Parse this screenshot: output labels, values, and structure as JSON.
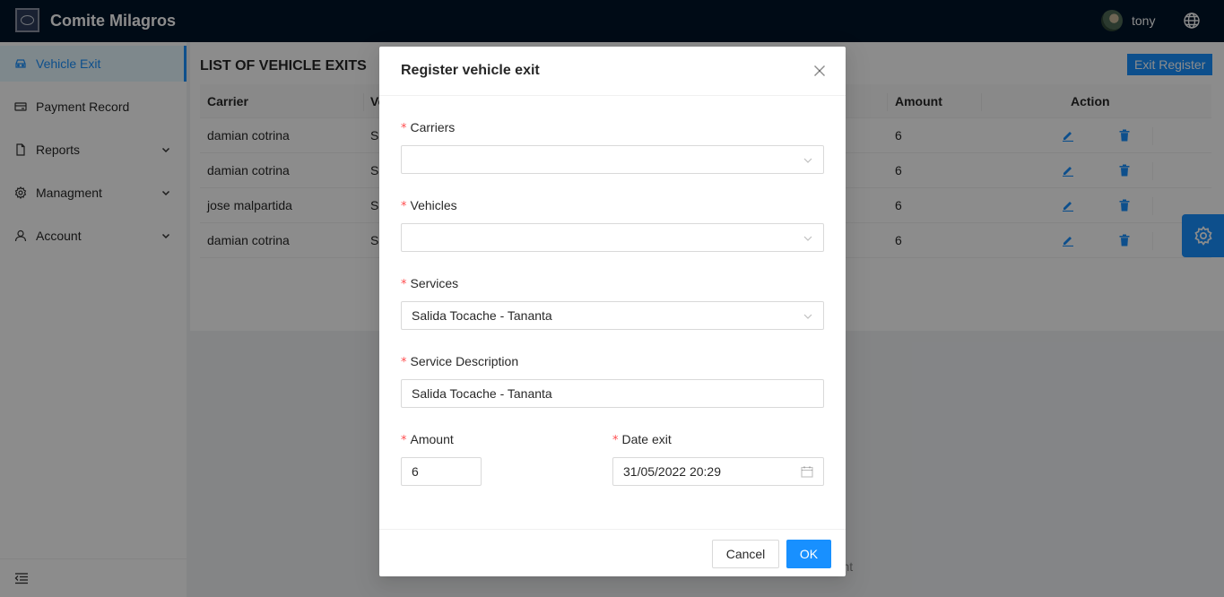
{
  "header": {
    "brand": "Comite Milagros",
    "user_name": "tony",
    "background": "#001529"
  },
  "sidebar": {
    "items": [
      {
        "label": "Vehicle Exit",
        "icon": "car-icon",
        "active": true
      },
      {
        "label": "Payment Record",
        "icon": "credit-card-icon"
      },
      {
        "label": "Reports",
        "icon": "file-icon",
        "expandable": true
      },
      {
        "label": "Managment",
        "icon": "setting-icon",
        "expandable": true
      },
      {
        "label": "Account",
        "icon": "user-icon",
        "expandable": true
      }
    ]
  },
  "page": {
    "title": "LIST OF VEHICLE EXITS",
    "exit_register_label": "Exit Register",
    "footer_fragment": "ment"
  },
  "table": {
    "columns": {
      "carrier": "Carrier",
      "vehicle": "Ve",
      "amount": "Amount",
      "action": "Action"
    },
    "rows": [
      {
        "carrier": "damian cotrina",
        "vehicle": "S.",
        "amount": "6"
      },
      {
        "carrier": "damian cotrina",
        "vehicle": "S.",
        "amount": "6"
      },
      {
        "carrier": "jose malpartida",
        "vehicle": "S.",
        "amount": "6"
      },
      {
        "carrier": "damian cotrina",
        "vehicle": "S.",
        "amount": "6"
      }
    ]
  },
  "modal": {
    "title": "Register vehicle exit",
    "required_mark": "*",
    "fields": {
      "carriers": {
        "label": "Carriers",
        "value": ""
      },
      "vehicles": {
        "label": "Vehicles",
        "value": ""
      },
      "services": {
        "label": "Services",
        "value": "Salida Tocache - Tananta"
      },
      "service_description": {
        "label": "Service Description",
        "value": "Salida Tocache - Tananta"
      },
      "amount": {
        "label": "Amount",
        "value": "6"
      },
      "date_exit": {
        "label": "Date exit",
        "value": "31/05/2022 20:29"
      }
    },
    "cancel_label": "Cancel",
    "ok_label": "OK"
  },
  "colors": {
    "primary": "#1890ff",
    "required": "#ff4d4f"
  }
}
